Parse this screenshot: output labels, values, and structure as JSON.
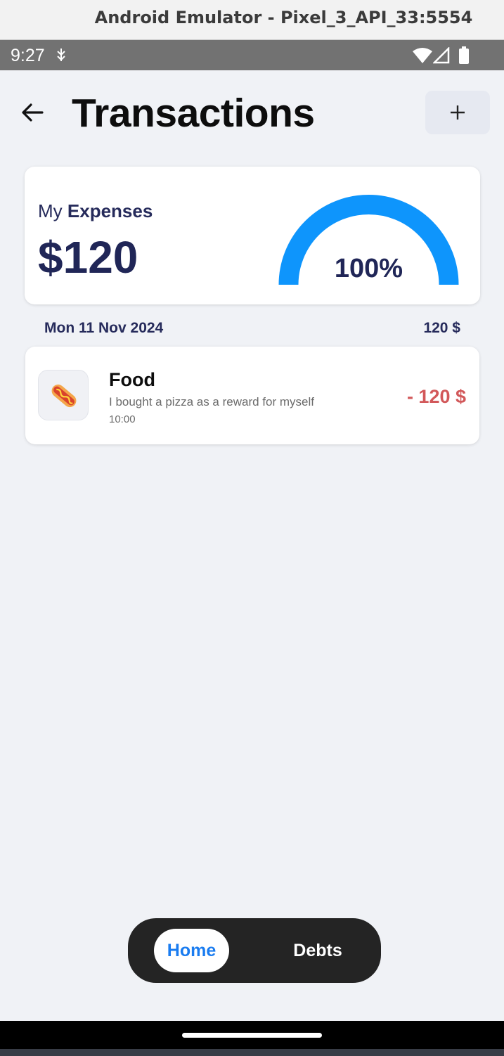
{
  "window": {
    "title": "Android Emulator - Pixel_3_API_33:5554"
  },
  "status_bar": {
    "time": "9:27",
    "icons": [
      "usb-debug-icon",
      "wifi-icon",
      "signal-icon",
      "battery-icon"
    ]
  },
  "header": {
    "title": "Transactions",
    "back_icon": "arrow-left-icon",
    "add_icon": "plus-icon"
  },
  "summary": {
    "label_prefix": "My",
    "label_bold": "Expenses",
    "amount": "$120",
    "gauge_percent_label": "100%",
    "gauge_fraction": 1.0,
    "gauge_color": "#0e95fc"
  },
  "groups": [
    {
      "date": "Mon 11 Nov 2024",
      "total": "120 $",
      "transactions": [
        {
          "category": "Food",
          "icon": "hotdog-icon",
          "note": "I bought a pizza as a reward for myself",
          "time": "10:00",
          "amount": "- 120 $",
          "amount_color": "#d2585a"
        }
      ]
    }
  ],
  "bottom_nav": {
    "items": [
      {
        "label": "Home",
        "active": true
      },
      {
        "label": "Debts",
        "active": false
      }
    ],
    "active_color": "#1a7cf0"
  }
}
